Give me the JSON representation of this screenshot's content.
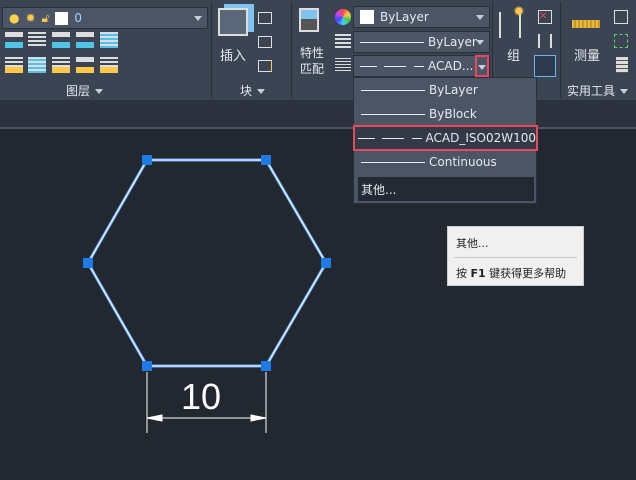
{
  "layer": {
    "current_layer": "0",
    "panel_title": "图层"
  },
  "block": {
    "insert_label": "插入",
    "panel_title": "块"
  },
  "properties": {
    "match_label_1": "特性",
    "match_label_2": "匹配",
    "color": "ByLayer",
    "lineweight": "ByLayer",
    "linetype": "ACAD..."
  },
  "group": {
    "label": "组"
  },
  "utilities": {
    "measure_label": "测量",
    "panel_title": "实用工具"
  },
  "linetype_menu": {
    "items": [
      "ByLayer",
      "ByBlock",
      "ACAD_ISO02W100",
      "Continuous"
    ],
    "selected": "ACAD_ISO02W100",
    "other": "其他..."
  },
  "tooltip": {
    "title": "其他...",
    "help_prefix": "按 ",
    "help_key": "F1",
    "help_suffix": " 键获得更多帮助"
  },
  "drawing": {
    "dimension": "10"
  },
  "colors": {
    "accent": "#e8495b",
    "selection": "#1e7be6",
    "geometry": "#ffffff"
  }
}
